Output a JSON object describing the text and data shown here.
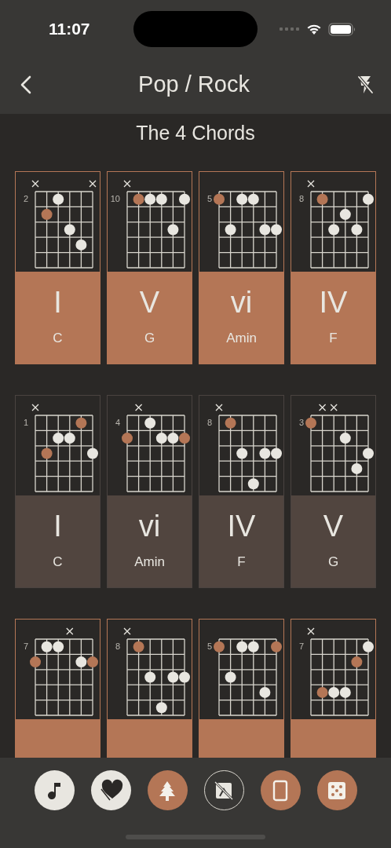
{
  "status_bar": {
    "time": "11:07"
  },
  "nav": {
    "title": "Pop / Rock"
  },
  "subtitle": "The 4 Chords",
  "progressions": [
    {
      "selected": true,
      "chords": [
        {
          "numeral": "I",
          "name": "C",
          "fret": "2"
        },
        {
          "numeral": "V",
          "name": "G",
          "fret": "10"
        },
        {
          "numeral": "vi",
          "name": "Amin",
          "fret": "5"
        },
        {
          "numeral": "IV",
          "name": "F",
          "fret": "8"
        }
      ]
    },
    {
      "selected": false,
      "chords": [
        {
          "numeral": "I",
          "name": "C",
          "fret": "1"
        },
        {
          "numeral": "vi",
          "name": "Amin",
          "fret": "4"
        },
        {
          "numeral": "IV",
          "name": "F",
          "fret": "8"
        },
        {
          "numeral": "V",
          "name": "G",
          "fret": "3"
        }
      ]
    },
    {
      "selected": true,
      "chords": [
        {
          "fret": "7"
        },
        {
          "fret": "8"
        },
        {
          "fret": "5"
        },
        {
          "fret": "7"
        }
      ]
    }
  ],
  "toolbar": [
    {
      "kind": "light"
    },
    {
      "kind": "light"
    },
    {
      "kind": "accent"
    },
    {
      "kind": "outline"
    },
    {
      "kind": "accent"
    },
    {
      "kind": "accent"
    }
  ]
}
